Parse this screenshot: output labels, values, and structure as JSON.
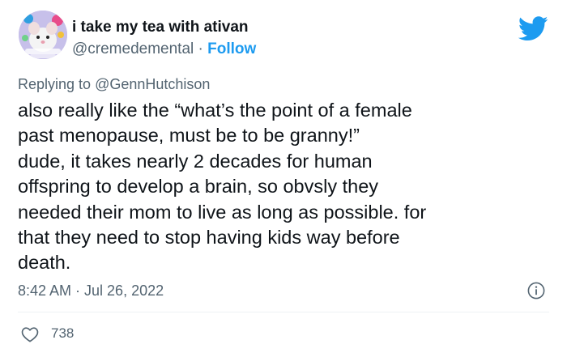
{
  "author": {
    "display_name": "i take my tea with ativan",
    "handle": "@cremedemental",
    "separator": "·",
    "follow_label": "Follow"
  },
  "reply": {
    "prefix": "Replying to",
    "mention": "@GennHutchison"
  },
  "tweet_text": "also really like the “what’s the point of a female\npast menopause, must be to be granny!”\ndude, it takes nearly 2 decades for human\noffspring to develop a brain, so obvsly they\nneeded their mom to live as long as possible. for\nthat they need to stop having kids way before\ndeath.",
  "timestamp": "8:42 AM · Jul 26, 2022",
  "likes": "738",
  "icons": {
    "brand": "twitter-bird-icon",
    "info": "info-icon",
    "like": "heart-icon"
  },
  "colors": {
    "brand_blue": "#1d9bf0",
    "secondary_text": "#536471",
    "primary_text": "#0f1419"
  }
}
